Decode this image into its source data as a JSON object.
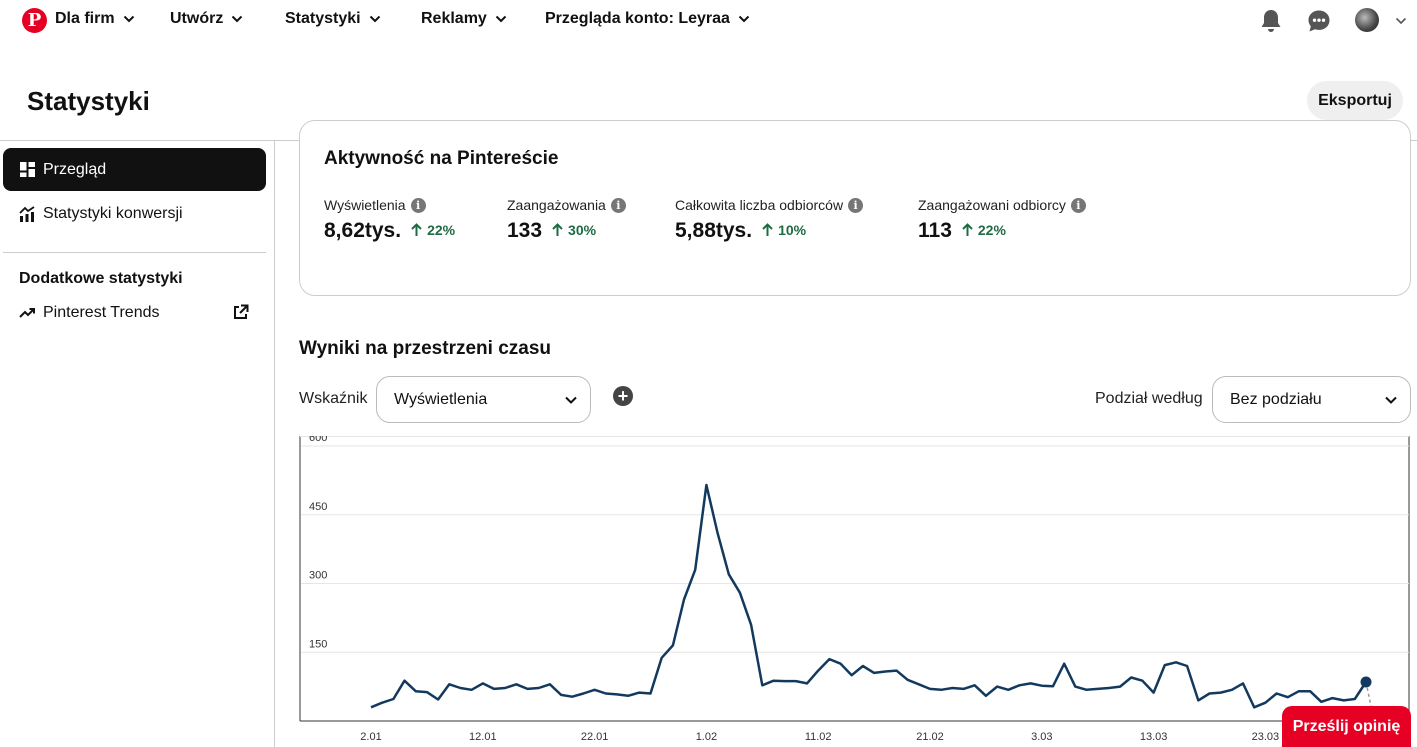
{
  "nav": {
    "business": "Dla firm",
    "create": "Utwórz",
    "analytics": "Statystyki",
    "ads": "Reklamy",
    "viewing_account": "Przegląda konto: Leyraa"
  },
  "header": {
    "title": "Statystyki",
    "export_label": "Eksportuj"
  },
  "sidebar": {
    "items": [
      {
        "label": "Przegląd",
        "icon": "dashboard-icon",
        "active": true
      },
      {
        "label": "Statystyki konwersji",
        "icon": "conversion-chart-icon",
        "active": false
      }
    ],
    "additional_heading": "Dodatkowe statystyki",
    "trends": {
      "label": "Pinterest Trends",
      "icon": "trend-icon",
      "external_icon": "external-link-icon"
    }
  },
  "activity": {
    "title": "Aktywność na Pintereście",
    "metrics": [
      {
        "label": "Wyświetlenia",
        "value": "8,62tys.",
        "change": "22%"
      },
      {
        "label": "Zaangażowania",
        "value": "133",
        "change": "30%"
      },
      {
        "label": "Całkowita liczba odbiorców",
        "value": "5,88tys.",
        "change": "10%"
      },
      {
        "label": "Zaangażowani odbiorcy",
        "value": "113",
        "change": "22%"
      }
    ],
    "change_color": "#1f6b44"
  },
  "results": {
    "title": "Wyniki na przestrzeni czasu",
    "metric_label": "Wskaźnik",
    "metric_value": "Wyświetlenia",
    "split_label": "Podział według",
    "split_value": "Bez podziału"
  },
  "chart_data": {
    "type": "line",
    "ylim": [
      0,
      600
    ],
    "yticks": [
      150,
      300,
      450,
      600
    ],
    "xtick_labels": [
      "2.01",
      "12.01",
      "22.01",
      "1.02",
      "11.02",
      "21.02",
      "3.03",
      "13.03",
      "23.03"
    ],
    "grid": true,
    "line_color": "#133a5e",
    "start_day_label": "2.01",
    "series": [
      {
        "values": [
          30,
          40,
          48,
          88,
          65,
          63,
          47,
          80,
          72,
          68,
          82,
          70,
          72,
          80,
          70,
          72,
          80,
          57,
          53,
          60,
          68,
          60,
          58,
          55,
          62,
          60,
          138,
          165,
          265,
          330,
          515,
          410,
          320,
          280,
          210,
          78,
          88,
          87,
          87,
          82,
          110,
          135,
          125,
          100,
          120,
          105,
          108,
          110,
          90,
          80,
          70,
          68,
          72,
          70,
          78,
          55,
          75,
          68,
          78,
          82,
          77,
          76,
          125,
          75,
          68,
          70,
          72,
          75,
          95,
          88,
          62,
          122,
          128,
          120,
          45,
          60,
          62,
          68,
          82,
          30,
          40,
          60,
          52,
          65,
          65,
          42,
          50,
          45,
          48,
          85
        ]
      }
    ]
  },
  "feedback_label": "Prześlij opinię"
}
